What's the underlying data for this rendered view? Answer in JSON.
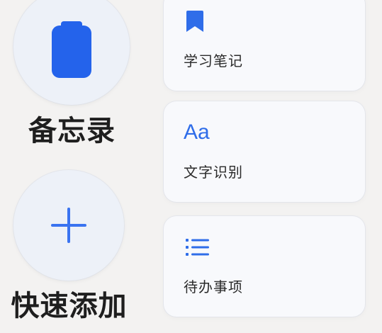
{
  "colors": {
    "accent": "#2463eb",
    "icon_blue": "#2f6de9",
    "background": "#f3f2f1",
    "card_bg": "#f8f9fc",
    "circle_bg": "#edf1f8"
  },
  "left_panel": {
    "memo": {
      "icon": "clipboard-icon",
      "label": "备忘录"
    },
    "quick_add": {
      "icon": "plus-icon",
      "label": "快速添加"
    }
  },
  "cards": {
    "notes": {
      "icon": "bookmark-icon",
      "label": "学习笔记"
    },
    "ocr": {
      "icon": "text-aa-icon",
      "icon_text": "Aa",
      "label": "文字识别"
    },
    "todo": {
      "icon": "list-icon",
      "label": "待办事项"
    }
  }
}
